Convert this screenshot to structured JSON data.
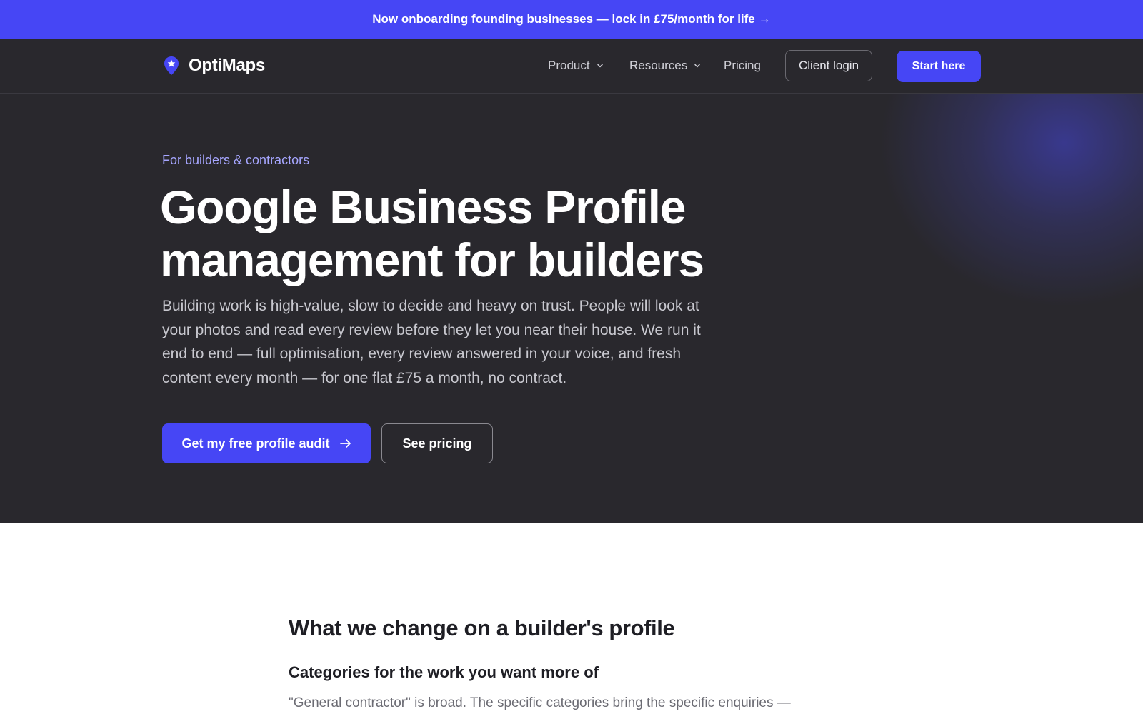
{
  "announcement": {
    "text": "Now onboarding founding businesses — lock in £75/month for life",
    "arrow": "→"
  },
  "nav": {
    "brand": "OptiMaps",
    "brand_icon": "map-pin-star-icon",
    "links": [
      {
        "label": "Product",
        "has_dropdown": true
      },
      {
        "label": "Resources",
        "has_dropdown": true
      },
      {
        "label": "Pricing",
        "has_dropdown": false
      }
    ],
    "login_label": "Client login",
    "start_label": "Start here"
  },
  "hero": {
    "eyebrow": "For builders & contractors",
    "headline_line1": "Google Business Profile",
    "headline_line2": "management for builders",
    "lead": "Building work is high-value, slow to decide and heavy on trust. People will look at your photos and read every review before they let you near their house. We run it end to end — full optimisation, every review answered in your voice, and fresh content every month — for one flat £75 a month, no contract.",
    "primary_cta": "Get my free profile audit",
    "secondary_cta": "See pricing"
  },
  "section": {
    "title": "What we change on a builder's profile",
    "subtitle": "Categories for the work you want more of",
    "body": "\"General contractor\" is broad. The specific categories bring the specific enquiries —"
  },
  "colors": {
    "accent": "#4646f5",
    "dark_bg": "#29282d",
    "eyebrow": "#a6a6ff"
  }
}
